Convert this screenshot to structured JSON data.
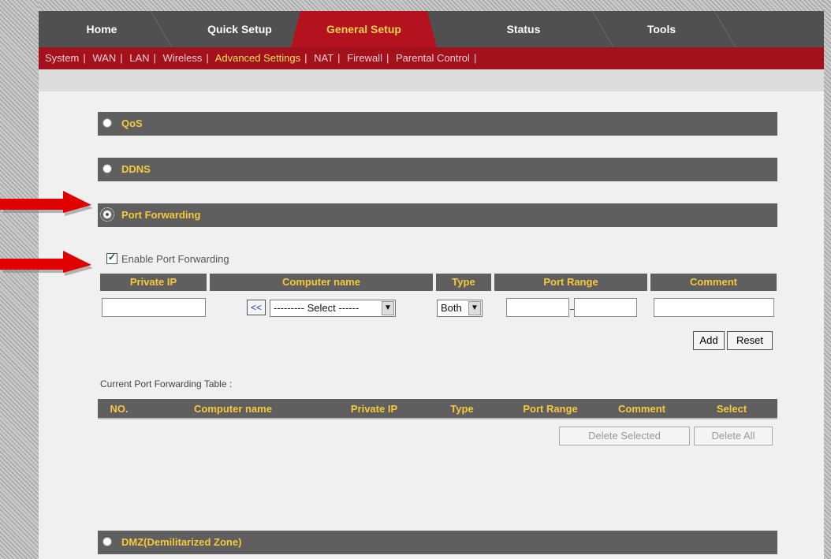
{
  "tabs": [
    "Home",
    "Quick Setup",
    "General Setup",
    "Status",
    "Tools"
  ],
  "active_tab": "General Setup",
  "subnav": [
    "System",
    "WAN",
    "LAN",
    "Wireless",
    "Advanced Settings",
    "NAT",
    "Firewall",
    "Parental Control"
  ],
  "active_subnav": "Advanced Settings",
  "sections": {
    "qos": "QoS",
    "ddns": "DDNS",
    "port_forwarding": "Port Forwarding",
    "dmz": "DMZ(Demilitarized Zone)"
  },
  "enable_label": "Enable Port Forwarding",
  "form_headers": [
    "Private IP",
    "Computer name",
    "Type",
    "Port Range",
    "Comment"
  ],
  "copy_button": "<<",
  "computer_select": "--------- Select ------",
  "type_select": "Both",
  "add_button": "Add",
  "reset_button": "Reset",
  "table_caption": "Current Port Forwarding Table :",
  "table_headers": [
    "NO.",
    "Computer name",
    "Private IP",
    "Type",
    "Port Range",
    "Comment",
    "Select"
  ],
  "delete_selected": "Delete Selected",
  "delete_all": "Delete All",
  "colors": {
    "tab_bar": "#505050",
    "accent_red": "#a3111d",
    "section_bar": "#5f5f5f",
    "header_text": "#f7c93c"
  }
}
